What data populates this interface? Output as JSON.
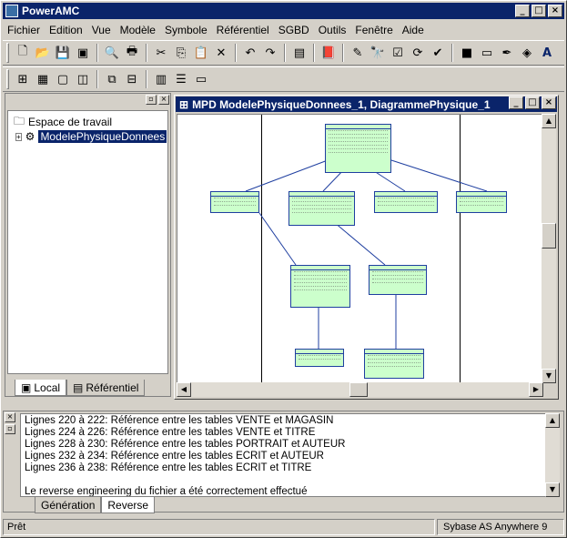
{
  "app": {
    "title": "PowerAMC"
  },
  "menu": [
    "Fichier",
    "Edition",
    "Vue",
    "Modèle",
    "Symbole",
    "Référentiel",
    "SGBD",
    "Outils",
    "Fenêtre",
    "Aide"
  ],
  "tree": {
    "root": "Espace de travail",
    "child": "ModelePhysiqueDonnees"
  },
  "tree_tabs": {
    "local": "Local",
    "repo": "Référentiel"
  },
  "diagram": {
    "title": "MPD ModelePhysiqueDonnees_1, DiagrammePhysique_1"
  },
  "output": {
    "lines": [
      "Lignes  220 à  222:  Référence entre les tables VENTE et MAGASIN",
      "Lignes  224 à  226:  Référence entre les tables VENTE et TITRE",
      "Lignes  228 à  230:  Référence entre les tables PORTRAIT et AUTEUR",
      "Lignes  232 à  234:  Référence entre les tables ECRIT et AUTEUR",
      "Lignes  236 à  238:  Référence entre les tables ECRIT et TITRE",
      "",
      "Le reverse engineering du fichier a été correctement effectué"
    ],
    "tabs": [
      "Génération",
      "Reverse"
    ]
  },
  "status": {
    "left": "Prêt",
    "right": "Sybase AS Anywhere 9"
  },
  "colors": {
    "titlebar": "#0a246a",
    "table_fill": "#ccffcc",
    "table_border": "#1f3fa0"
  }
}
